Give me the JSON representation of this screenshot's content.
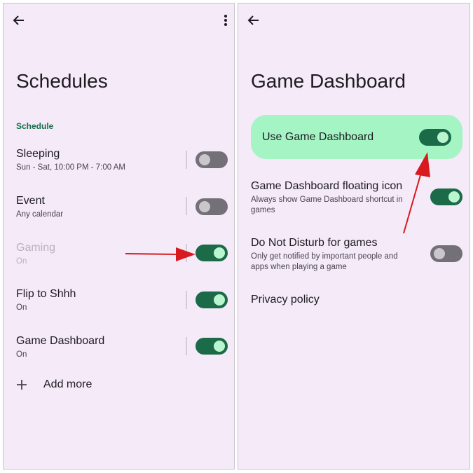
{
  "left": {
    "title": "Schedules",
    "section_label": "Schedule",
    "items": [
      {
        "title": "Sleeping",
        "subtitle": "Sun - Sat, 10:00 PM - 7:00 AM",
        "enabled": false
      },
      {
        "title": "Event",
        "subtitle": "Any calendar",
        "enabled": false
      },
      {
        "title": "Gaming",
        "subtitle": "On",
        "enabled": true
      },
      {
        "title": "Flip to Shhh",
        "subtitle": "On",
        "enabled": true
      },
      {
        "title": "Game Dashboard",
        "subtitle": "On",
        "enabled": true
      }
    ],
    "add_more_label": "Add more",
    "icons": [
      "back-arrow-icon",
      "more-vert-icon",
      "plus-icon"
    ]
  },
  "right": {
    "title": "Game Dashboard",
    "main_toggle": {
      "label": "Use Game Dashboard",
      "enabled": true
    },
    "items": [
      {
        "title": "Game Dashboard floating icon",
        "subtitle": "Always show Game Dashboard shortcut in games",
        "enabled": true
      },
      {
        "title": "Do Not Disturb for games",
        "subtitle": "Only get notified by important people and apps when playing a game",
        "enabled": false
      }
    ],
    "privacy_label": "Privacy policy",
    "icons": [
      "back-arrow-icon"
    ]
  },
  "colors": {
    "background": "#f4eaf8",
    "accent_green": "#1b6a48",
    "highlight": "#a4f4c4",
    "annotation_arrow": "#d8191f"
  }
}
